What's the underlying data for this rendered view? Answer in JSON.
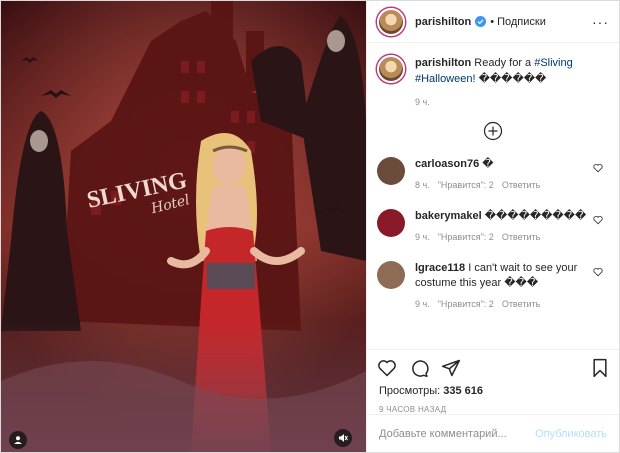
{
  "header": {
    "username": "parishilton",
    "separator": "•",
    "follow_label": "Подписки",
    "more_label": "···"
  },
  "caption": {
    "username": "parishilton",
    "text_prefix": " Ready for a ",
    "hashtag1": "#Sliving",
    "hashtag2": "#Halloween!",
    "emoji": " ������",
    "time": "9 ч."
  },
  "comments": [
    {
      "username": "carloason76",
      "text": " �",
      "time": "8 ч.",
      "likes": "\"Нравится\": 2",
      "reply": "Ответить",
      "avatar_color": "#6b4b3a"
    },
    {
      "username": "bakerymakel",
      "text": " ���������",
      "time": "9 ч.",
      "likes": "\"Нравится\": 2",
      "reply": "Ответить",
      "avatar_color": "#8a1a2a"
    },
    {
      "username": "lgrace118",
      "text": " I can't wait to see your costume this year ���",
      "time": "9 ч.",
      "likes": "\"Нравится\": 2",
      "reply": "Ответить",
      "avatar_color": "#8d6b55"
    }
  ],
  "stats": {
    "views_label": "Просмотры:",
    "views_value": "335 616",
    "posted_ago": "9 ЧАСОВ НАЗАД"
  },
  "add_comment": {
    "placeholder": "Добавьте комментарий...",
    "publish_label": "Опубликовать"
  },
  "media": {
    "sign_text": "SLIVING",
    "sign_sub": "Hotel"
  },
  "colors": {
    "link": "#00376b",
    "verified": "#3897f0",
    "muted": "#8e8e8e",
    "publish_disabled": "#b2dffc"
  }
}
